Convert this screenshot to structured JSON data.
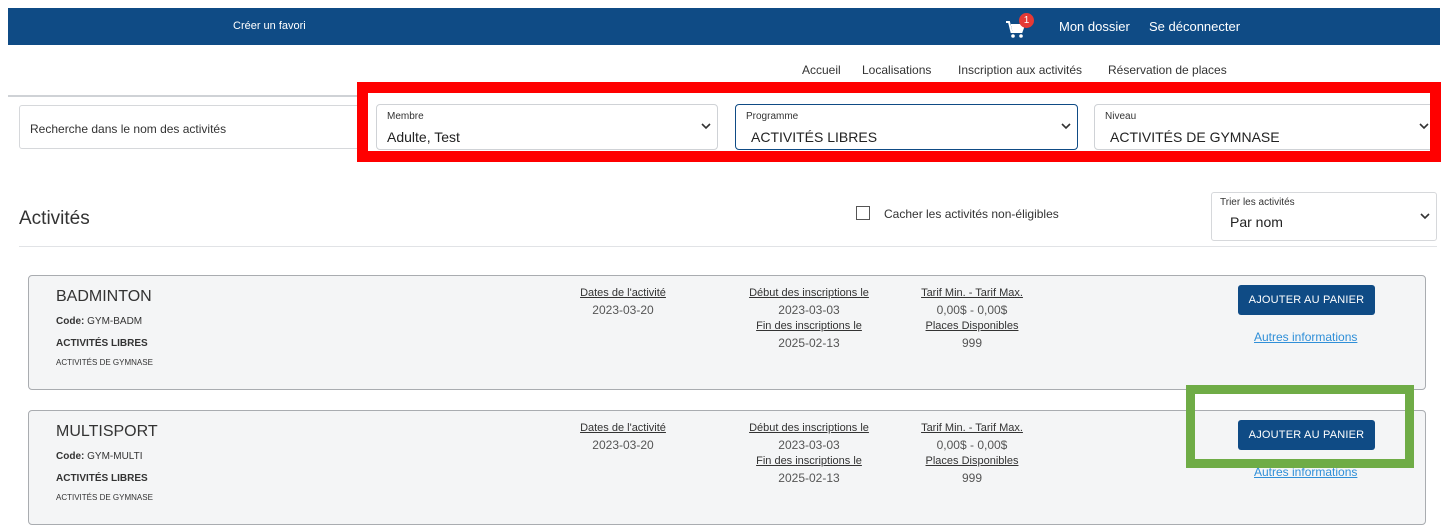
{
  "topbar": {
    "favorite_link": "Créer un favori",
    "cart_count": "1",
    "my_file": "Mon dossier",
    "logout": "Se déconnecter",
    "color": "#0f4b85"
  },
  "nav": [
    "Accueil",
    "Localisations",
    "Inscription aux activités",
    "Réservation de places"
  ],
  "search": {
    "placeholder": "Recherche dans le nom des activités"
  },
  "filters": {
    "member": {
      "label": "Membre",
      "value": "Adulte, Test"
    },
    "program": {
      "label": "Programme",
      "value": "ACTIVITÉS LIBRES"
    },
    "level": {
      "label": "Niveau",
      "value": "ACTIVITÉS DE GYMNASE"
    }
  },
  "section": {
    "title": "Activités",
    "hide_ineligible": "Cacher les activités non-éligibles",
    "sort_label": "Trier les activités",
    "sort_value": "Par nom"
  },
  "columns": {
    "dates": "Dates de l'activité",
    "reg_start": "Début des inscriptions le",
    "reg_end": "Fin des inscriptions le",
    "price": "Tarif Min. - Tarif Max.",
    "places": "Places Disponibles",
    "add_button": "AJOUTER AU PANIER",
    "more_info": "Autres informations",
    "code_label": "Code:"
  },
  "activities": [
    {
      "name": "BADMINTON",
      "code": "GYM-BADM",
      "program": "ACTIVITÉS LIBRES",
      "level": "ACTIVITÉS DE GYMNASE",
      "date": "2023-03-20",
      "reg_start": "2023-03-03",
      "reg_end": "2025-02-13",
      "price": "0,00$ - 0,00$",
      "places": "999"
    },
    {
      "name": "MULTISPORT",
      "code": "GYM-MULTI",
      "program": "ACTIVITÉS LIBRES",
      "level": "ACTIVITÉS DE GYMNASE",
      "date": "2023-03-20",
      "reg_start": "2023-03-03",
      "reg_end": "2025-02-13",
      "price": "0,00$ - 0,00$",
      "places": "999"
    }
  ],
  "highlights": {
    "red": "#ff0000",
    "green": "#6fac46"
  }
}
